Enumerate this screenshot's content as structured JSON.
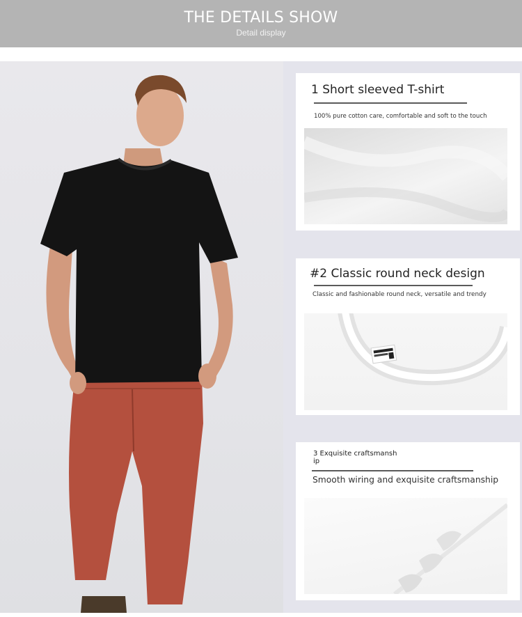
{
  "header": {
    "title": "THE DETAILS SHOW",
    "subtitle": "Detail display"
  },
  "photo": {
    "icon": "model-photo",
    "colors": {
      "shirt": "#141414",
      "pants": "#b4503e",
      "skin": "#d9a487",
      "background": "#e6e6ea"
    }
  },
  "details": [
    {
      "title": "1 Short sleeved T-shirt",
      "description": "100% pure cotton care, comfortable and soft to the touch",
      "image": "fabric-closeup"
    },
    {
      "title": "#2 Classic round neck design",
      "description": "Classic and fashionable round neck, versatile and trendy",
      "image": "neckline-closeup"
    },
    {
      "title": "3 Exquisite craftsmansh ip",
      "description": "Smooth wiring and exquisite craftsmanship",
      "image": "seam-closeup"
    }
  ],
  "colors": {
    "header_bg": "#b4b4b4",
    "panel_bg": "#e4e4ec",
    "card_bg": "#ffffff",
    "rule": "#5a5a5a"
  }
}
